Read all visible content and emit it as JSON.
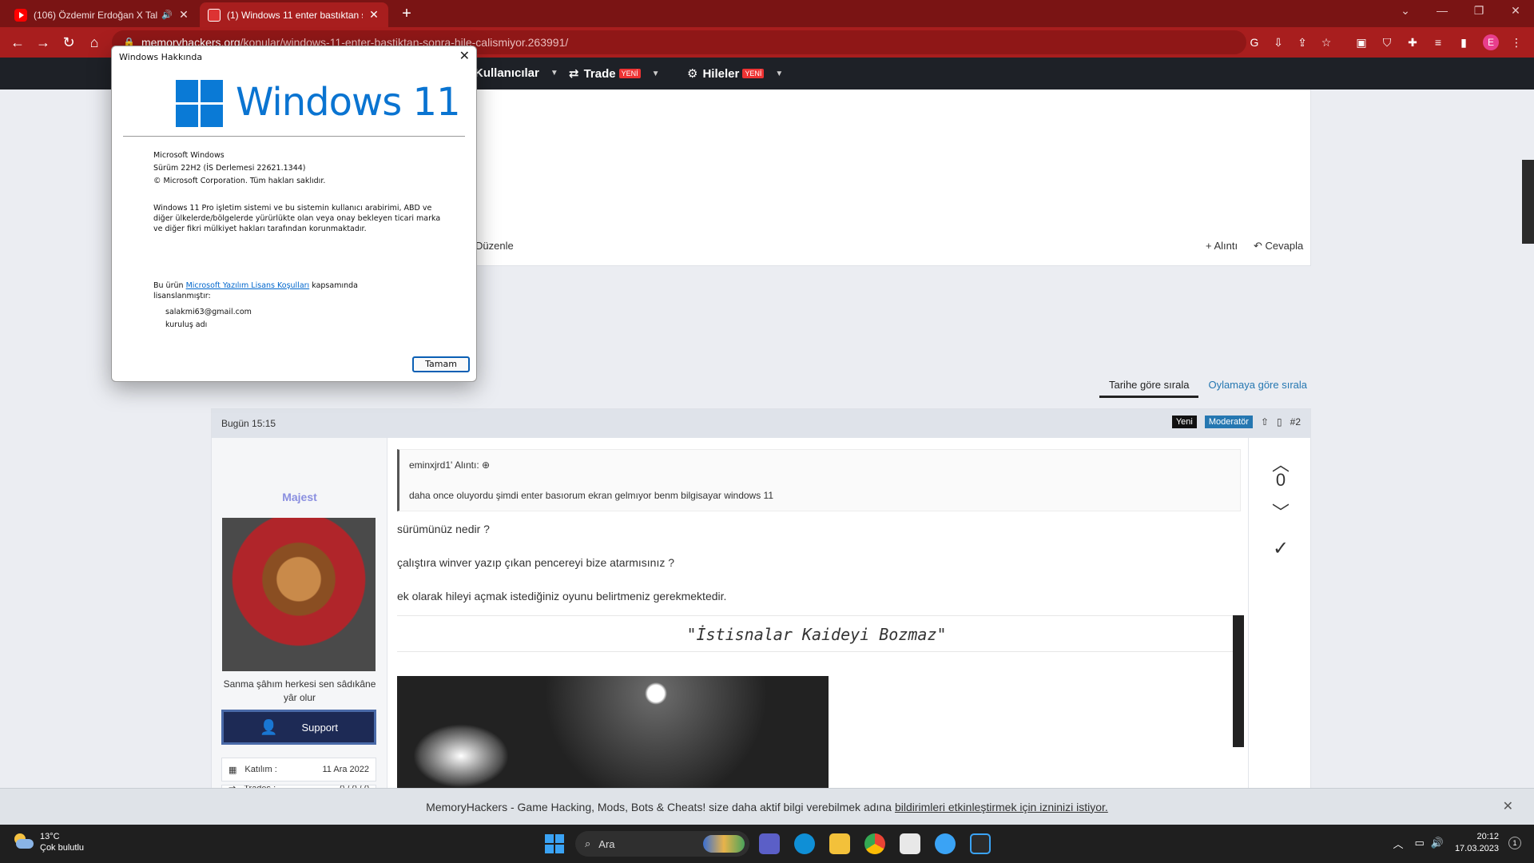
{
  "browser": {
    "tabs": [
      {
        "title": "(106) Özdemir Erdoğan X Tal..."
      },
      {
        "title": "(1) Windows 11 enter bastıktan s..."
      }
    ],
    "url_host": "memoryhackers.org",
    "url_path": "/konular/windows-11-enter-bastiktan-sonra-hile-calismiyor.263991/",
    "avatar_letter": "E"
  },
  "site_nav": {
    "items": [
      {
        "label": "Kullanıcılar",
        "badge": ""
      },
      {
        "label": "Trade",
        "badge": "YENİ"
      },
      {
        "label": "Hileler",
        "badge": "YENİ"
      }
    ]
  },
  "post1": {
    "edit_label": "Düzenle",
    "quote_label": "Alıntı",
    "reply_label": "Cevapla"
  },
  "sort_tabs": [
    {
      "label": "Tarihe göre sırala"
    },
    {
      "label": "Oylamaya göre sırala"
    }
  ],
  "post2": {
    "date": "Bugün 15:15",
    "tag_new": "Yeni",
    "tag_mod": "Moderatör",
    "number": "#2",
    "username": "Majest",
    "tagline": "Sanma şâhım herkesi sen sâdıkâne yâr olur",
    "support_label": "Support",
    "stats": [
      {
        "label": "Katılım :",
        "value": "11 Ara 2022"
      },
      {
        "label": "Trades :",
        "value": "0 / 0 / 0"
      }
    ],
    "quote_author": "eminxjrd1' Alıntı:",
    "quote_text": "daha once oluyordu şimdi enter basıorum ekran gelmıyor benm bilgisayar windows 11",
    "lines": [
      "sürümünüz nedir ?",
      "çalıştıra winver yazıp çıkan pencereyi bize atarmısınız ?",
      "ek olarak hileyi açmak istediğiniz oyunu belirtmeniz gerekmektedir."
    ],
    "signature": "\"İstisnalar Kaideyi Bozmaz\"",
    "vote_count": "0"
  },
  "notification": {
    "text": "MemoryHackers - Game Hacking, Mods, Bots & Cheats! size daha aktif bilgi verebilmek adına",
    "link": "bildirimleri etkinleştirmek için izninizi istiyor."
  },
  "windows_dialog": {
    "title": "Windows Hakkında",
    "logo_text": "Windows 11",
    "info": [
      "Microsoft Windows",
      "Sürüm 22H2 (İS Derlemesi 22621.1344)",
      "© Microsoft Corporation. Tüm hakları saklıdır."
    ],
    "legal": "Windows 11 Pro işletim sistemi ve bu sistemin kullanıcı arabirimi, ABD ve diğer ülkelerde/bölgelerde yürürlükte olan veya onay bekleyen ticari marka ve diğer fikri mülkiyet hakları tarafından korunmaktadır.",
    "license_prefix": "Bu ürün",
    "license_link": "Microsoft Yazılım Lisans Koşulları",
    "license_suffix": "kapsamında lisanslanmıştır:",
    "licensee_email": "salakmi63@gmail.com",
    "licensee_org": "kuruluş adı",
    "ok_label": "Tamam"
  },
  "taskbar": {
    "temperature": "13°C",
    "weather": "Çok bulutlu",
    "search_placeholder": "Ara",
    "time": "20:12",
    "date": "17.03.2023",
    "notif_count": "1"
  }
}
